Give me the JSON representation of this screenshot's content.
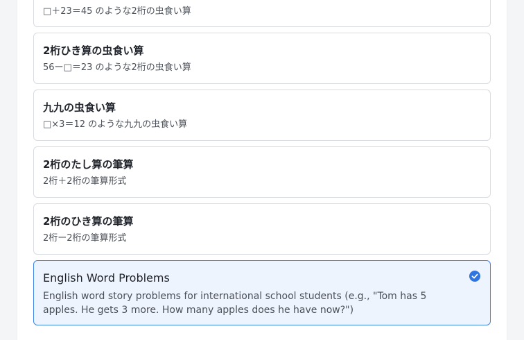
{
  "options": [
    {
      "desc": "□＋23＝45 のような2桁の虫食い算"
    },
    {
      "title": "2桁ひき算の虫食い算",
      "desc": "56ー□＝23 のような2桁の虫食い算"
    },
    {
      "title": "九九の虫食い算",
      "desc": "□×3＝12 のような九九の虫食い算"
    },
    {
      "title": "2桁のたし算の筆算",
      "desc": "2桁＋2桁の筆算形式"
    },
    {
      "title": "2桁のひき算の筆算",
      "desc": "2桁ー2桁の筆算形式"
    },
    {
      "title": "English Word Problems",
      "desc": "English word story problems for international school students (e.g., \"Tom has 5 apples. He gets 3 more. How many apples does he have now?\")",
      "selected": true
    }
  ],
  "colors": {
    "accent": "#2f74e0",
    "selected_bg": "#eef4fd"
  },
  "icons": {
    "selected": "check-circle-icon"
  }
}
